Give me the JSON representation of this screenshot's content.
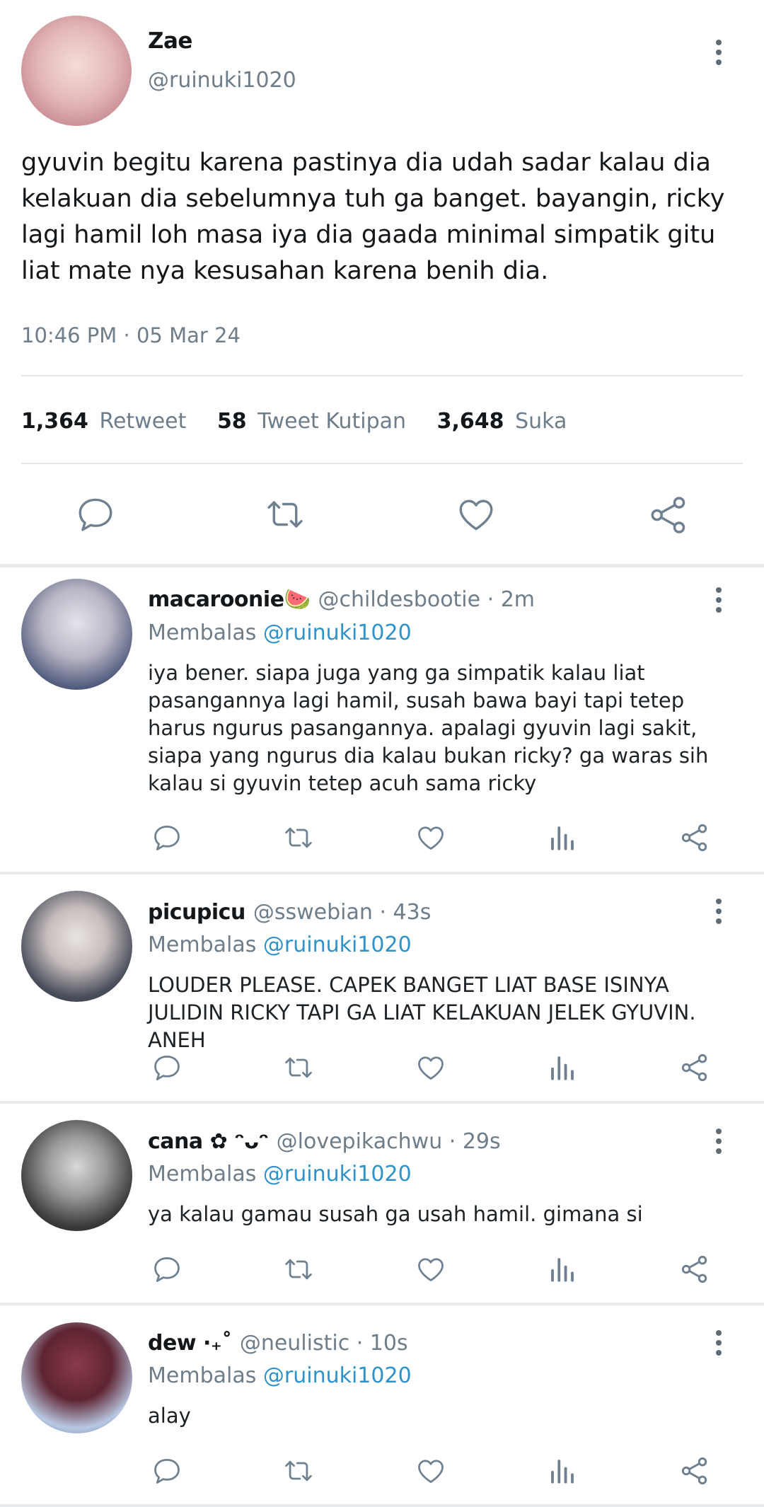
{
  "tweet": {
    "display_name": "Zae",
    "handle": "@ruinuki1020",
    "text": "gyuvin begitu karena pastinya dia udah sadar kalau dia kelakuan dia sebelumnya tuh ga banget. bayangin, ricky lagi hamil loh masa iya dia gaada minimal simpatik gitu liat mate nya kesusahan karena benih dia.",
    "timestamp": "10:46 PM · 05 Mar 24",
    "stats": {
      "retweets": "1,364",
      "retweets_label": "Retweet",
      "quotes": "58",
      "quotes_label": "Tweet Kutipan",
      "likes": "3,648",
      "likes_label": "Suka"
    }
  },
  "replies": [
    {
      "display_name": "macaroonie🍉",
      "handle_time": "@childesbootie · 2m",
      "replying_prefix": "Membalas",
      "replying_to": "@ruinuki1020",
      "text": "iya bener. siapa juga yang ga simpatik kalau liat pasangannya lagi hamil, susah bawa bayi tapi tetep harus ngurus pasangannya. apalagi gyuvin lagi sakit, siapa yang ngurus dia kalau bukan ricky? ga waras sih kalau si gyuvin tetep acuh sama ricky"
    },
    {
      "display_name": "picupicu",
      "handle_time": "@sswebian · 43s",
      "replying_prefix": "Membalas",
      "replying_to": "@ruinuki1020",
      "text": "LOUDER PLEASE. CAPEK BANGET LIAT BASE ISINYA JULIDIN RICKY TAPI GA LIAT KELAKUAN JELEK GYUVIN. ANEH"
    },
    {
      "display_name": "cana ✿ ᵔᴗᵔ",
      "handle_time": "@lovepikachwu · 29s",
      "replying_prefix": "Membalas",
      "replying_to": "@ruinuki1020",
      "text": "ya kalau gamau susah ga usah hamil. gimana si"
    },
    {
      "display_name": "dew ·₊˚",
      "handle_time": "@neulistic · 10s",
      "replying_prefix": "Membalas",
      "replying_to": "@ruinuki1020",
      "text": "alay"
    }
  ],
  "colors": {
    "link": "#2f92c9",
    "muted": "#6e7d8a",
    "icon": "#6f8190",
    "divider": "#e3e7ea"
  }
}
